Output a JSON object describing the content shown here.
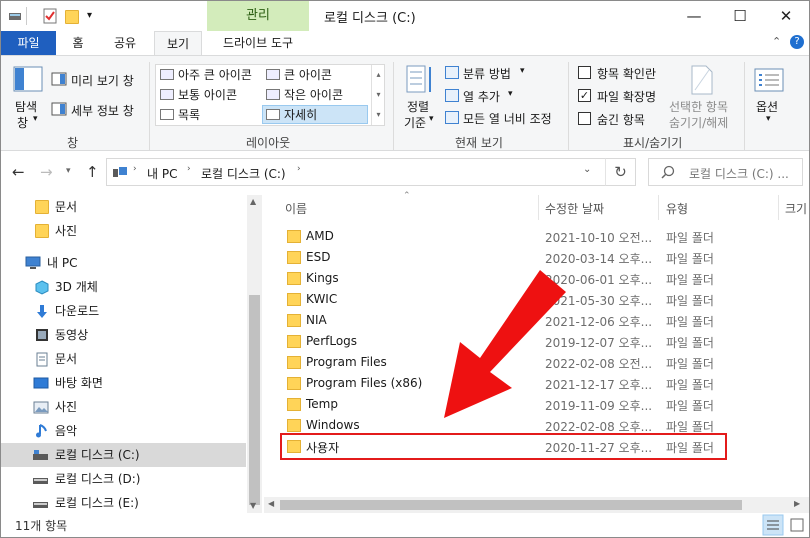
{
  "titlebar": {
    "context_tab": "관리",
    "title": "로컬 디스크 (C:)",
    "minimize": "—",
    "maximize": "☐",
    "close": "✕"
  },
  "ribbon_tabs": [
    "파일",
    "홈",
    "공유",
    "보기",
    "드라이브 도구"
  ],
  "ribbon": {
    "pane_group": {
      "nav_pane": "탐색",
      "nav_pane_2": "창",
      "preview": "미리 보기 창",
      "details": "세부 정보 창",
      "label": "창"
    },
    "layout_group": {
      "items": [
        "아주 큰 아이콘",
        "큰 아이콘",
        "보통 아이콘",
        "작은 아이콘",
        "목록",
        "자세히"
      ],
      "selected": "자세히",
      "label": "레이아웃"
    },
    "current_view": {
      "sort_1": "정렬",
      "sort_2": "기준",
      "group_by": "분류 방법",
      "add_columns": "열 추가",
      "size_all_columns": "모든 열 너비 조정",
      "label": "현재 보기"
    },
    "show_hide": {
      "item_checkboxes": "항목 확인란",
      "item_checkboxes_checked": false,
      "file_extensions": "파일 확장명",
      "file_extensions_checked": true,
      "hidden_items": "숨긴 항목",
      "hidden_items_checked": false,
      "hide_selected_1": "선택한 항목",
      "hide_selected_2": "숨기기/해제",
      "label": "표시/숨기기"
    },
    "options": "옵션"
  },
  "address": {
    "crumbs": [
      "내 PC",
      "로컬 디스크 (C:)"
    ],
    "search_placeholder": "로컬 디스크 (C:) ..."
  },
  "nav_pane": [
    {
      "label": "문서",
      "icon": "folder-icon"
    },
    {
      "label": "사진",
      "icon": "folder-icon"
    },
    {
      "label": "내 PC",
      "icon": "pc-icon"
    },
    {
      "label": "3D 개체",
      "icon": "cube-icon"
    },
    {
      "label": "다운로드",
      "icon": "download-icon"
    },
    {
      "label": "동영상",
      "icon": "video-icon"
    },
    {
      "label": "문서",
      "icon": "document-icon"
    },
    {
      "label": "바탕 화면",
      "icon": "desktop-icon"
    },
    {
      "label": "사진",
      "icon": "picture-icon"
    },
    {
      "label": "음악",
      "icon": "music-icon"
    },
    {
      "label": "로컬 디스크 (C:)",
      "icon": "drive-icon"
    },
    {
      "label": "로컬 디스크 (D:)",
      "icon": "drive-icon"
    },
    {
      "label": "로컬 디스크 (E:)",
      "icon": "drive-icon"
    }
  ],
  "columns": {
    "name": "이름",
    "date": "수정한 날짜",
    "type": "유형",
    "size": "크기"
  },
  "files": [
    {
      "name": "AMD",
      "date": "2021-10-10 오전...",
      "type": "파일 폴더"
    },
    {
      "name": "ESD",
      "date": "2020-03-14 오후...",
      "type": "파일 폴더"
    },
    {
      "name": "Kings",
      "date": "2020-06-01 오후...",
      "type": "파일 폴더"
    },
    {
      "name": "KWIC",
      "date": "2021-05-30 오후...",
      "type": "파일 폴더"
    },
    {
      "name": "NIA",
      "date": "2021-12-06 오후...",
      "type": "파일 폴더"
    },
    {
      "name": "PerfLogs",
      "date": "2019-12-07 오후...",
      "type": "파일 폴더"
    },
    {
      "name": "Program Files",
      "date": "2022-02-08 오전...",
      "type": "파일 폴더"
    },
    {
      "name": "Program Files (x86)",
      "date": "2021-12-17 오후...",
      "type": "파일 폴더"
    },
    {
      "name": "Temp",
      "date": "2019-11-09 오후...",
      "type": "파일 폴더"
    },
    {
      "name": "Windows",
      "date": "2022-02-08 오후...",
      "type": "파일 폴더"
    },
    {
      "name": "사용자",
      "date": "2020-11-27 오후...",
      "type": "파일 폴더"
    }
  ],
  "status": "11개 항목",
  "colors": {
    "accent": "#1f5fbf",
    "highlight": "#e31b1b",
    "arrow": "#ee1111",
    "context_tab": "#d3ecbb"
  }
}
